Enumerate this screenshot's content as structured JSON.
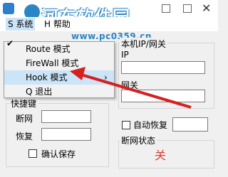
{
  "menubar": {
    "items": [
      "S 系统",
      "H 帮助"
    ]
  },
  "watermark": {
    "site_name": "河东软件园",
    "url": "www.pc0359.cn"
  },
  "dropdown": {
    "items": [
      {
        "label": "Route 模式"
      },
      {
        "label": "FireWall 模式"
      },
      {
        "label": "Hook 模式",
        "submenu_glyph": "›"
      },
      {
        "label": "Q 退出"
      }
    ]
  },
  "group_ip": {
    "title": "本机IP/网关",
    "ip_label": "IP",
    "gateway_label": "网关",
    "ip_value": "",
    "gateway_value": ""
  },
  "group_hotkey": {
    "title": "快捷键",
    "disconnect_label": "断网",
    "restore_label": "恢复",
    "disconnect_value": "",
    "restore_value": "",
    "confirm_save_label": "确认保存"
  },
  "auto_restore": {
    "label": "自动恢复",
    "value": ""
  },
  "net_status": {
    "title": "断网状态",
    "value": "关"
  },
  "colors": {
    "status_text": "#e23b2e",
    "highlight": "#cce4f7",
    "arrow": "#d62020",
    "watermark": "#2b86c5"
  }
}
